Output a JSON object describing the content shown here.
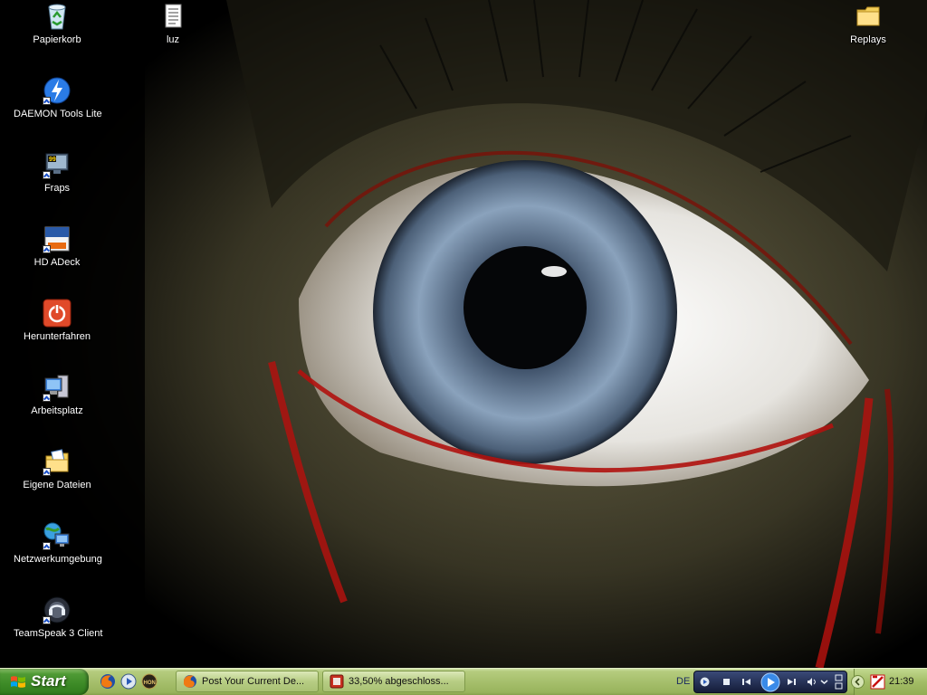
{
  "desktop": {
    "icons": [
      {
        "label": "Papierkorb",
        "icon": "recycle-bin-icon"
      },
      {
        "label": "luz",
        "icon": "text-file-icon"
      },
      {
        "label": "Replays",
        "icon": "folder-icon"
      },
      {
        "label": "DAEMON Tools Lite",
        "icon": "daemon-tools-icon"
      },
      {
        "label": "Fraps",
        "icon": "fraps-icon"
      },
      {
        "label": "HD ADeck",
        "icon": "hd-adeck-icon"
      },
      {
        "label": "Herunterfahren",
        "icon": "power-icon"
      },
      {
        "label": "Arbeitsplatz",
        "icon": "my-computer-icon"
      },
      {
        "label": "Eigene Dateien",
        "icon": "my-documents-icon"
      },
      {
        "label": "Netzwerkumgebung",
        "icon": "network-icon"
      },
      {
        "label": "TeamSpeak 3 Client",
        "icon": "teamspeak-icon"
      }
    ]
  },
  "taskbar": {
    "start_label": "Start",
    "quicklaunch": [
      "firefox-icon",
      "media-player-icon",
      "hon-icon"
    ],
    "buttons": [
      {
        "label": "Post Your Current De...",
        "icon": "firefox-icon"
      },
      {
        "label": "33,50% abgeschloss...",
        "icon": "download-icon"
      }
    ],
    "language": "DE",
    "clock": "21:39"
  },
  "colors": {
    "taskbar": "#a6bf6c",
    "start_button": "#3c8a26",
    "blood": "#b0120e",
    "iris": "#7c94b0"
  }
}
